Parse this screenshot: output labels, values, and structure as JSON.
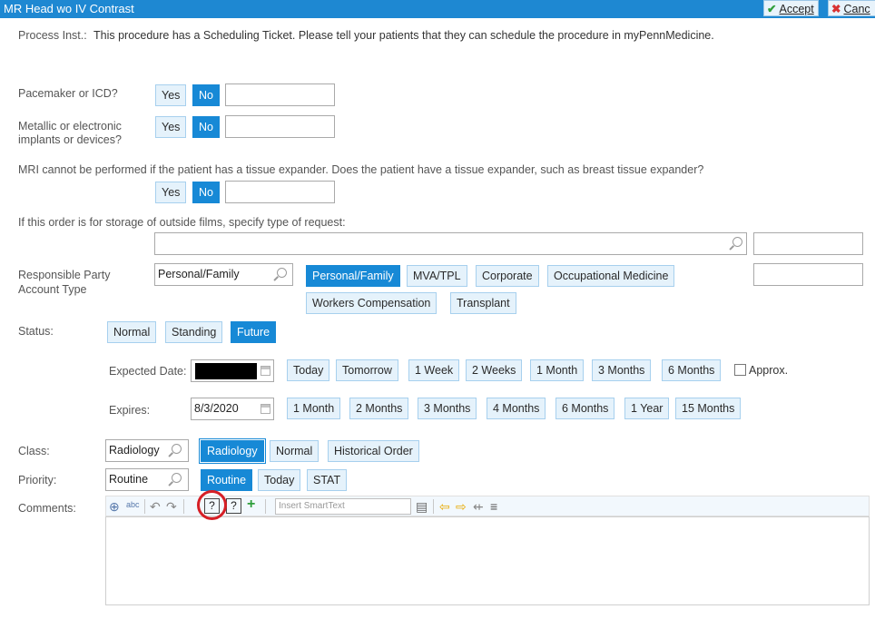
{
  "window": {
    "title": "MR Head wo IV Contrast",
    "accept_label": "Accept",
    "cancel_label": "Canc"
  },
  "process_inst": {
    "label": "Process Inst.:",
    "text": "This procedure has a Scheduling Ticket. Please tell your patients that they can schedule the procedure in myPennMedicine."
  },
  "questions": {
    "pacemaker": {
      "label": "Pacemaker or ICD?",
      "yes": "Yes",
      "no": "No",
      "selected": "No"
    },
    "implants": {
      "label_line1": "Metallic or electronic",
      "label_line2": "implants or devices?",
      "yes": "Yes",
      "no": "No",
      "selected": "No"
    },
    "tissue_expander": {
      "label": "MRI cannot be performed if the patient has a tissue expander. Does the patient have a tissue expander, such as breast tissue expander?",
      "yes": "Yes",
      "no": "No",
      "selected": "No"
    },
    "outside_films": {
      "label": "If this order is for storage of outside films, specify type of request:",
      "value": ""
    }
  },
  "responsible_party": {
    "label_line1": "Responsible Party",
    "label_line2": "Account Type",
    "value": "Personal/Family",
    "options": [
      "Personal/Family",
      "MVA/TPL",
      "Corporate",
      "Occupational Medicine",
      "Workers Compensation",
      "Transplant"
    ],
    "selected": "Personal/Family"
  },
  "status": {
    "label": "Status:",
    "options": [
      "Normal",
      "Standing",
      "Future"
    ],
    "selected": "Future",
    "expected_date_label": "Expected Date:",
    "expected_options": [
      "Today",
      "Tomorrow",
      "1 Week",
      "2 Weeks",
      "1 Month",
      "3 Months",
      "6 Months"
    ],
    "approx_label": "Approx.",
    "expires_label": "Expires:",
    "expires_value": "8/3/2020",
    "expires_options": [
      "1 Month",
      "2 Months",
      "3 Months",
      "4 Months",
      "6 Months",
      "1 Year",
      "15 Months"
    ]
  },
  "class": {
    "label": "Class:",
    "value": "Radiology",
    "options": [
      "Radiology",
      "Normal",
      "Historical Order"
    ],
    "selected": "Radiology"
  },
  "priority": {
    "label": "Priority:",
    "value": "Routine",
    "options": [
      "Routine",
      "Today",
      "STAT"
    ],
    "selected": "Routine"
  },
  "comments": {
    "label": "Comments:",
    "smarttext_placeholder": "Insert SmartText",
    "spell_glyph": "abc",
    "help_glyph": "?",
    "value": ""
  },
  "colors": {
    "titlebar": "#1e88d2",
    "selected": "#1789d6",
    "button_bg": "#e5f2fb",
    "highlight_circle": "#d61f26"
  }
}
